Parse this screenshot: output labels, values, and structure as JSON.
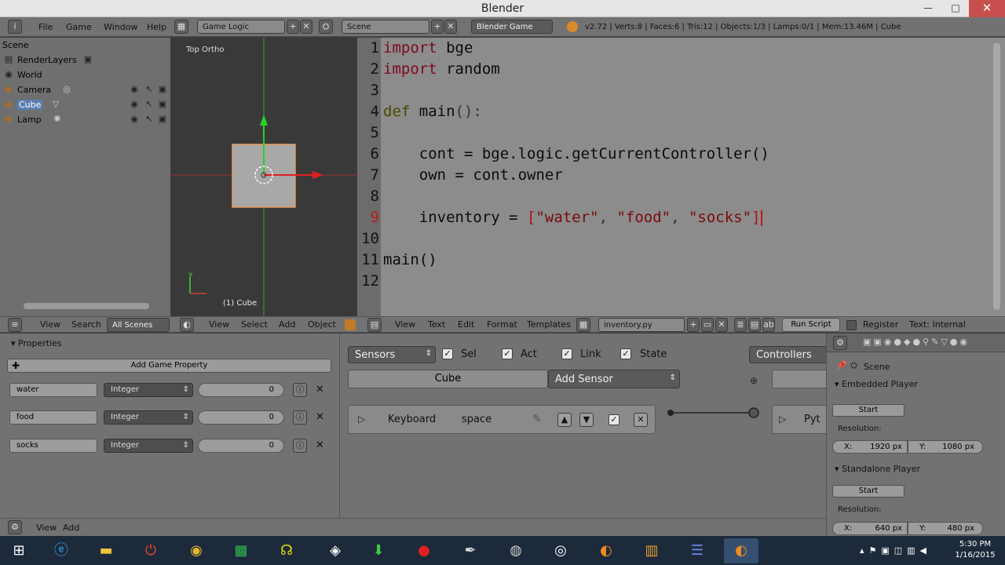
{
  "window": {
    "title": "Blender",
    "minimize": "—",
    "maximize": "□",
    "close": "✕"
  },
  "info_header": {
    "menus": [
      "File",
      "Game",
      "Window",
      "Help"
    ],
    "screen_layout": "Game Logic",
    "scene": "Scene",
    "engine": "Blender Game",
    "stats": "v2.72 | Verts:8 | Faces:6 | Tris:12 | Objects:1/3 | Lamps:0/1 | Mem:13.46M | Cube"
  },
  "outliner": {
    "items": [
      {
        "label": "Scene",
        "icon": "scene-icon"
      },
      {
        "label": "RenderLayers",
        "icon": "render-layers-icon"
      },
      {
        "label": "World",
        "icon": "world-icon"
      },
      {
        "label": "Camera",
        "icon": "camera-icon"
      },
      {
        "label": "Cube",
        "icon": "cube-icon"
      },
      {
        "label": "Lamp",
        "icon": "lamp-icon"
      }
    ]
  },
  "viewport": {
    "view_name": "Top Ortho",
    "object_label": "(1) Cube",
    "axis_y": "y"
  },
  "editor": {
    "line_numbers": [
      "1",
      "2",
      "3",
      "4",
      "5",
      "6",
      "7",
      "8",
      "9",
      "10",
      "11",
      "12"
    ],
    "lines": {
      "l1_kw": "import",
      "l1_rest": " bge",
      "l2_kw": "import",
      "l2_rest": " random",
      "l4_kw": "def",
      "l4_fn": " main",
      "l4_rest": "():",
      "l6": "    cont = bge.logic.getCurrentController()",
      "l7": "    own = cont.owner",
      "l9_a": "    inventory = ",
      "l9_b": "[",
      "l9_s1": "\"water\"",
      "l9_c1": ", ",
      "l9_s2": "\"food\"",
      "l9_c2": ", ",
      "l9_s3": "\"socks\"",
      "l9_e": "]",
      "l11": "main()"
    },
    "current_line": "9"
  },
  "mid_header": {
    "outliner_menus": [
      "View",
      "Search"
    ],
    "outliner_filter": "All Scenes",
    "viewport_menus": [
      "View",
      "Select",
      "Add",
      "Object"
    ],
    "text_menus": [
      "View",
      "Text",
      "Edit",
      "Format",
      "Templates"
    ],
    "text_file": "inventory.py",
    "run_script": "Run Script",
    "register": "Register",
    "text_status": "Text: Internal"
  },
  "properties": {
    "title": "Properties",
    "add_button": "Add Game Property",
    "items": [
      {
        "name": "water",
        "type": "Integer",
        "value": "0"
      },
      {
        "name": "food",
        "type": "Integer",
        "value": "0"
      },
      {
        "name": "socks",
        "type": "Integer",
        "value": "0"
      }
    ]
  },
  "logic": {
    "sensors_label": "Sensors",
    "checks": [
      "Sel",
      "Act",
      "Link",
      "State"
    ],
    "object": "Cube",
    "add_sensor": "Add Sensor",
    "sensor_type": "Keyboard",
    "sensor_key": "space",
    "controllers_label": "Controllers",
    "controller_short": "Pyt"
  },
  "side_panel": {
    "scene": "Scene",
    "embedded": "Embedded Player",
    "start": "Start",
    "resolution": "Resolution:",
    "embedded_x": "1920 px",
    "embedded_y": "1080 px",
    "standalone": "Standalone Player",
    "standalone_x": "640 px",
    "standalone_y": "480 px",
    "x_label": "X:",
    "y_label": "Y:"
  },
  "bottom_header": {
    "menus": [
      "View",
      "Add"
    ]
  },
  "taskbar": {
    "time": "5:30 PM",
    "date": "1/16/2015"
  }
}
